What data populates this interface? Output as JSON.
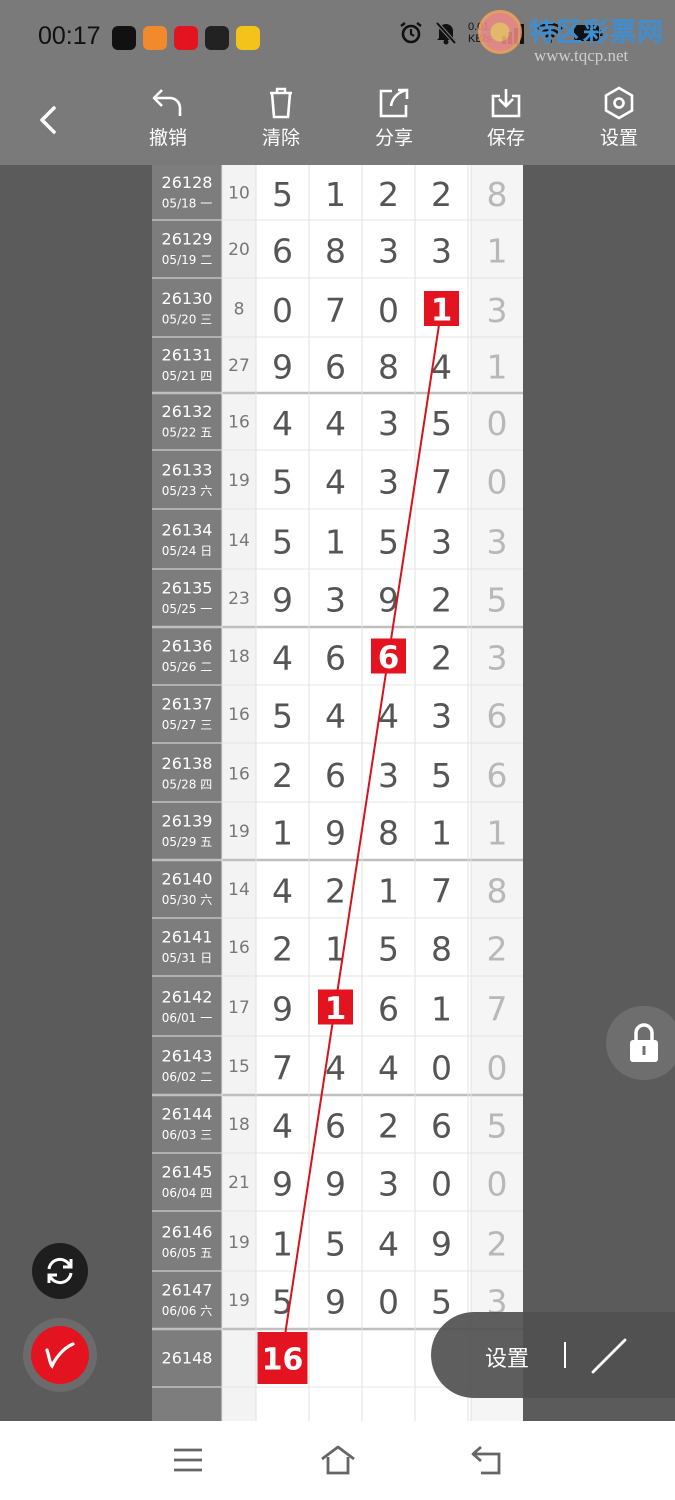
{
  "status_bar": {
    "time": "00:17",
    "net_speed_top": "0.01",
    "net_speed_bottom": "KB/s",
    "app_icons": [
      {
        "name": "tiktok-icon",
        "color": "#111111"
      },
      {
        "name": "video-app-icon",
        "color": "#f08a2c"
      },
      {
        "name": "heart-app-icon",
        "color": "#e3141f"
      },
      {
        "name": "lottery-app-icon",
        "color": "#222222"
      },
      {
        "name": "yellow-app-icon",
        "color": "#f3c21b"
      }
    ]
  },
  "watermark": {
    "title": "特区彩票网",
    "url": "www.tqcp.net"
  },
  "toolbar": {
    "undo_label": "撤销",
    "clear_label": "清除",
    "share_label": "分享",
    "save_label": "保存",
    "settings_label": "设置"
  },
  "board": {
    "rows": [
      {
        "issue": "26128",
        "date": "05/18 一",
        "sum": "10",
        "digits": [
          5,
          1,
          2,
          2
        ],
        "span": 8
      },
      {
        "issue": "26129",
        "date": "05/19 二",
        "sum": "20",
        "digits": [
          6,
          8,
          3,
          3
        ],
        "span": 1
      },
      {
        "issue": "26130",
        "date": "05/20 三",
        "sum": "8",
        "digits": [
          0,
          7,
          0,
          1
        ],
        "span": 3
      },
      {
        "issue": "26131",
        "date": "05/21 四",
        "sum": "27",
        "digits": [
          9,
          6,
          8,
          4
        ],
        "span": 1
      },
      {
        "issue": "26132",
        "date": "05/22 五",
        "sum": "16",
        "digits": [
          4,
          4,
          3,
          5
        ],
        "span": 0
      },
      {
        "issue": "26133",
        "date": "05/23 六",
        "sum": "19",
        "digits": [
          5,
          4,
          3,
          7
        ],
        "span": 0
      },
      {
        "issue": "26134",
        "date": "05/24 日",
        "sum": "14",
        "digits": [
          5,
          1,
          5,
          3
        ],
        "span": 3
      },
      {
        "issue": "26135",
        "date": "05/25 一",
        "sum": "23",
        "digits": [
          9,
          3,
          9,
          2
        ],
        "span": 5
      },
      {
        "issue": "26136",
        "date": "05/26 二",
        "sum": "18",
        "digits": [
          4,
          6,
          6,
          2
        ],
        "span": 3
      },
      {
        "issue": "26137",
        "date": "05/27 三",
        "sum": "16",
        "digits": [
          5,
          4,
          4,
          3
        ],
        "span": 6
      },
      {
        "issue": "26138",
        "date": "05/28 四",
        "sum": "16",
        "digits": [
          2,
          6,
          3,
          5
        ],
        "span": 6
      },
      {
        "issue": "26139",
        "date": "05/29 五",
        "sum": "19",
        "digits": [
          1,
          9,
          8,
          1
        ],
        "span": 1
      },
      {
        "issue": "26140",
        "date": "05/30 六",
        "sum": "14",
        "digits": [
          4,
          2,
          1,
          7
        ],
        "span": 8
      },
      {
        "issue": "26141",
        "date": "05/31 日",
        "sum": "16",
        "digits": [
          2,
          1,
          5,
          8
        ],
        "span": 2
      },
      {
        "issue": "26142",
        "date": "06/01 一",
        "sum": "17",
        "digits": [
          9,
          1,
          6,
          1
        ],
        "span": 7
      },
      {
        "issue": "26143",
        "date": "06/02 二",
        "sum": "15",
        "digits": [
          7,
          4,
          4,
          0
        ],
        "span": 0
      },
      {
        "issue": "26144",
        "date": "06/03 三",
        "sum": "18",
        "digits": [
          4,
          6,
          2,
          6
        ],
        "span": 5
      },
      {
        "issue": "26145",
        "date": "06/04 四",
        "sum": "21",
        "digits": [
          9,
          9,
          3,
          0
        ],
        "span": 0
      },
      {
        "issue": "26146",
        "date": "06/05 五",
        "sum": "19",
        "digits": [
          1,
          5,
          4,
          9
        ],
        "span": 2
      },
      {
        "issue": "26147",
        "date": "06/06 六",
        "sum": "19",
        "digits": [
          5,
          9,
          0,
          5
        ],
        "span": 3
      },
      {
        "issue": "26148",
        "date": "",
        "sum": "",
        "digits": [],
        "span": null
      }
    ],
    "highlights": [
      {
        "row": 2,
        "col": 3,
        "text": "1"
      },
      {
        "row": 8,
        "col": 2,
        "text": "6"
      },
      {
        "row": 14,
        "col": 1,
        "text": "1"
      },
      {
        "row": 20,
        "col": 0,
        "text": "16"
      }
    ],
    "trend_line": {
      "from": {
        "row": 2,
        "col": 3
      },
      "to": {
        "row": 20,
        "col": 0
      }
    },
    "colors": {
      "highlight": "#e3141f",
      "line": "#d8121c",
      "issue_bg": "#7d7d7d",
      "digit": "#555555",
      "span": "#b8b8b8",
      "sum": "#777777"
    }
  },
  "overlay": {
    "settings_label": "设置"
  }
}
